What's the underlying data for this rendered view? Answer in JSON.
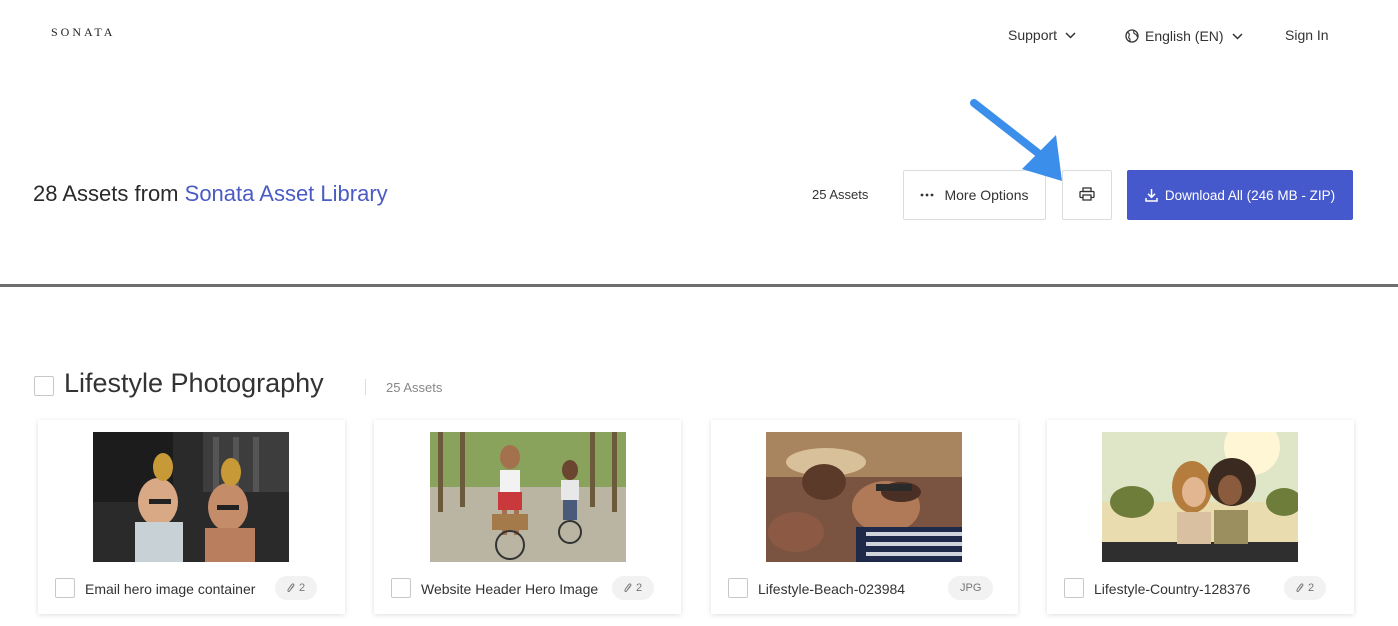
{
  "brand": {
    "logo_text": "SONATA"
  },
  "nav": {
    "support_label": "Support",
    "language_label": "English (EN)",
    "signin_label": "Sign In"
  },
  "header": {
    "title_prefix": "28 Assets from",
    "library_name": "Sonata Asset Library",
    "asset_count": "25 Assets",
    "more_options_label": "More Options",
    "download_label": "Download All (246 MB - ZIP)"
  },
  "colors": {
    "accent": "#4659cc",
    "link": "#4a5cc4",
    "annotation_arrow": "#3b8eea"
  },
  "section": {
    "title": "Lifestyle Photography",
    "count": "25 Assets"
  },
  "cards": [
    {
      "title": "Email hero image container",
      "badge": "2",
      "badge_icon": "paperclip-icon"
    },
    {
      "title": "Website Header Hero Image",
      "badge": "2",
      "badge_icon": "paperclip-icon"
    },
    {
      "title": "Lifestyle-Beach-023984",
      "badge": "JPG",
      "badge_icon": ""
    },
    {
      "title": "Lifestyle-Country-128376",
      "badge": "2",
      "badge_icon": "paperclip-icon"
    }
  ]
}
